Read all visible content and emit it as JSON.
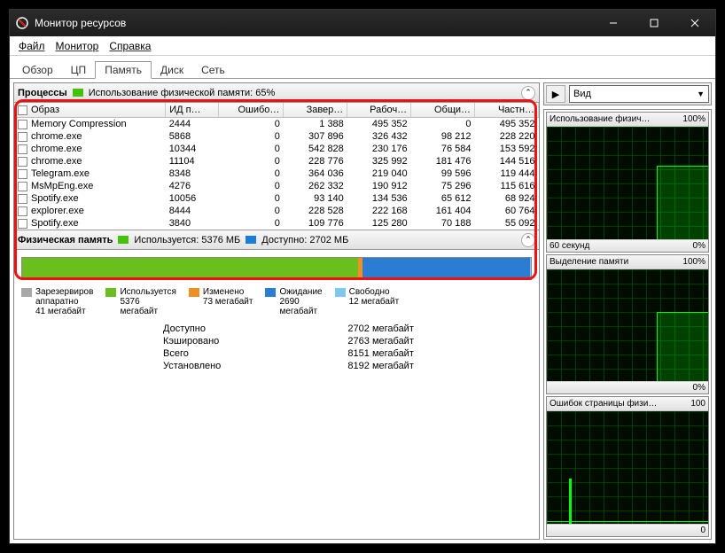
{
  "window": {
    "title": "Монитор ресурсов"
  },
  "menu": {
    "file": "Файл",
    "monitor": "Монитор",
    "help": "Справка"
  },
  "tabs": {
    "overview": "Обзор",
    "cpu": "ЦП",
    "memory": "Память",
    "disk": "Диск",
    "network": "Сеть"
  },
  "processes": {
    "header": "Процессы",
    "usage_label": "Использование физической памяти: 65%",
    "columns": {
      "image": "Образ",
      "pid": "ИД п…",
      "hard_faults": "Ошибо…",
      "commit": "Завер…",
      "ws": "Рабоч…",
      "shareable": "Общи…",
      "private": "Частн…"
    },
    "rows": [
      {
        "image": "Memory Compression",
        "pid": "2444",
        "faults": "0",
        "commit": "1 388",
        "ws": "495 352",
        "shareable": "0",
        "private": "495 352"
      },
      {
        "image": "chrome.exe",
        "pid": "5868",
        "faults": "0",
        "commit": "307 896",
        "ws": "326 432",
        "shareable": "98 212",
        "private": "228 220"
      },
      {
        "image": "chrome.exe",
        "pid": "10344",
        "faults": "0",
        "commit": "542 828",
        "ws": "230 176",
        "shareable": "76 584",
        "private": "153 592"
      },
      {
        "image": "chrome.exe",
        "pid": "11104",
        "faults": "0",
        "commit": "228 776",
        "ws": "325 992",
        "shareable": "181 476",
        "private": "144 516"
      },
      {
        "image": "Telegram.exe",
        "pid": "8348",
        "faults": "0",
        "commit": "364 036",
        "ws": "219 040",
        "shareable": "99 596",
        "private": "119 444"
      },
      {
        "image": "MsMpEng.exe",
        "pid": "4276",
        "faults": "0",
        "commit": "262 332",
        "ws": "190 912",
        "shareable": "75 296",
        "private": "115 616"
      },
      {
        "image": "Spotify.exe",
        "pid": "10056",
        "faults": "0",
        "commit": "93 140",
        "ws": "134 536",
        "shareable": "65 612",
        "private": "68 924"
      },
      {
        "image": "explorer.exe",
        "pid": "8444",
        "faults": "0",
        "commit": "228 528",
        "ws": "222 168",
        "shareable": "161 404",
        "private": "60 764"
      },
      {
        "image": "Spotify.exe",
        "pid": "3840",
        "faults": "0",
        "commit": "109 776",
        "ws": "125 280",
        "shareable": "70 188",
        "private": "55 092"
      }
    ]
  },
  "physical": {
    "header": "Физическая память",
    "in_use_label": "Используется: 5376 МБ",
    "available_label": "Доступно: 2702 МБ",
    "legend": {
      "reserved": {
        "label": "Зарезервиров",
        "sub": "аппаратно",
        "value": "41 мегабайт"
      },
      "in_use": {
        "label": "Используется",
        "value": "5376\nмегабайт"
      },
      "modified": {
        "label": "Изменено",
        "value": "73 мегабайт"
      },
      "standby": {
        "label": "Ожидание",
        "value": "2690\nмегабайт"
      },
      "free": {
        "label": "Свободно",
        "value": "12 мегабайт"
      }
    },
    "stats": {
      "available_l": "Доступно",
      "available_v": "2702 мегабайт",
      "cached_l": "Кэшировано",
      "cached_v": "2763 мегабайт",
      "total_l": "Всего",
      "total_v": "8151 мегабайт",
      "installed_l": "Установлено",
      "installed_v": "8192 мегабайт"
    }
  },
  "side": {
    "view": "Вид",
    "chart1": {
      "title": "Использование физич…",
      "max": "100%",
      "foot_l": "60 секунд",
      "foot_r": "0%"
    },
    "chart2": {
      "title": "Выделение памяти",
      "max": "100%",
      "foot_r": "0%"
    },
    "chart3": {
      "title": "Ошибок страницы физи…",
      "max": "100",
      "foot_r": "0"
    }
  },
  "colors": {
    "reserved": "#a8a8a8",
    "in_use": "#6bbf1d",
    "modified": "#f19022",
    "standby": "#2b7cd3",
    "free": "#7fc6f0"
  }
}
